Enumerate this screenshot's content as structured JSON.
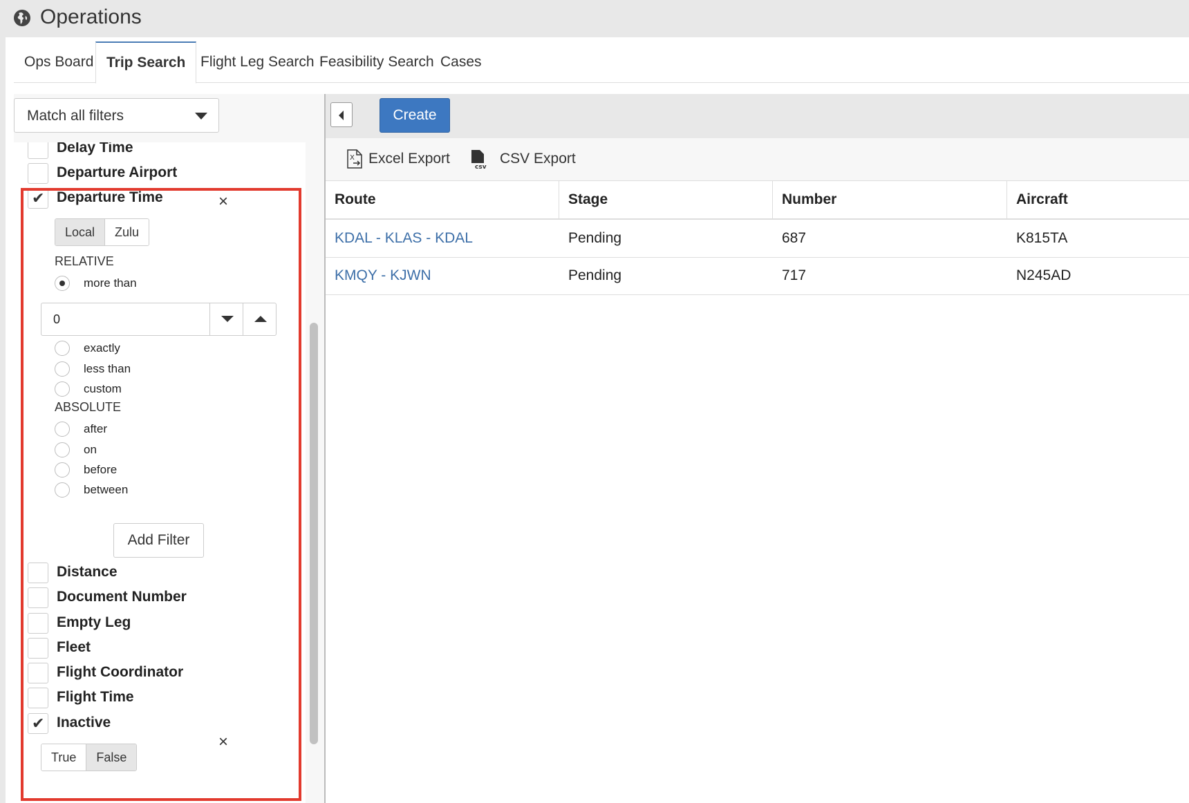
{
  "app": {
    "title": "Operations",
    "header_icon": "globe-icon"
  },
  "tabs": [
    {
      "label": "Ops Board",
      "active": false
    },
    {
      "label": "Trip Search",
      "active": true
    },
    {
      "label": "Flight Leg Search",
      "active": false
    },
    {
      "label": "Feasibility Search",
      "active": false
    },
    {
      "label": "Cases",
      "active": false
    }
  ],
  "filters": {
    "match_mode": "Match all filters",
    "items": [
      {
        "label": "Delay Time",
        "checked": false
      },
      {
        "label": "Departure Airport",
        "checked": false
      },
      {
        "label": "Departure Time",
        "checked": true
      },
      {
        "label": "Distance",
        "checked": false
      },
      {
        "label": "Document Number",
        "checked": false
      },
      {
        "label": "Empty Leg",
        "checked": false
      },
      {
        "label": "Fleet",
        "checked": false
      },
      {
        "label": "Flight Coordinator",
        "checked": false
      },
      {
        "label": "Flight Time",
        "checked": false
      },
      {
        "label": "Inactive",
        "checked": true
      }
    ],
    "departure_time": {
      "close_glyph": "×",
      "zone_options": [
        "Local",
        "Zulu"
      ],
      "zone_selected": "Local",
      "relative_caption": "RELATIVE",
      "relative_options": [
        "more than",
        "exactly",
        "less than",
        "custom"
      ],
      "relative_selected": "more than",
      "amount_value": "0",
      "absolute_caption": "ABSOLUTE",
      "absolute_options": [
        "after",
        "on",
        "before",
        "between"
      ],
      "add_filter_label": "Add Filter"
    },
    "inactive": {
      "close_glyph": "×",
      "options": [
        "True",
        "False"
      ],
      "selected": "False"
    }
  },
  "toolbar": {
    "create_label": "Create"
  },
  "exports": {
    "excel_label": "Excel Export",
    "csv_label": "CSV Export"
  },
  "grid": {
    "columns": [
      "Route",
      "Stage",
      "Number",
      "Aircraft"
    ],
    "rows": [
      {
        "route": "KDAL - KLAS - KDAL",
        "stage": "Pending",
        "number": "687",
        "aircraft": "K815TA"
      },
      {
        "route": "KMQY - KJWN",
        "stage": "Pending",
        "number": "717",
        "aircraft": "N245AD"
      }
    ]
  },
  "colors": {
    "accent": "#3d78c1",
    "link": "#3d6fa8",
    "highlight_border": "#e23a2e",
    "header_bg": "#e8e8e8"
  }
}
